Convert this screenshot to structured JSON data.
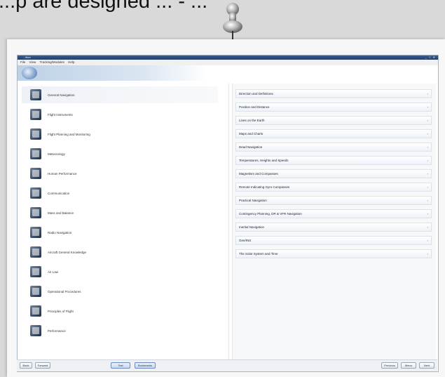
{
  "caption": "...p are designed ... - ...",
  "window": {
    "title": "...ition",
    "controls": "_ □ ✕"
  },
  "menu": [
    "File",
    "View",
    "Tracking/Modules",
    "Help"
  ],
  "left_items": [
    {
      "label": "General Navigation",
      "selected": true,
      "icon": "navigation-icon"
    },
    {
      "label": "Flight Instruments",
      "icon": "instruments-icon"
    },
    {
      "label": "Flight Planning and Monitoring",
      "icon": "planning-icon"
    },
    {
      "label": "Meteorology",
      "icon": "weather-icon"
    },
    {
      "label": "Human Performance",
      "icon": "human-icon"
    },
    {
      "label": "Communication",
      "icon": "radio-icon"
    },
    {
      "label": "Mass and Balance",
      "icon": "scale-icon"
    },
    {
      "label": "Radio Navigation",
      "icon": "radio-nav-icon"
    },
    {
      "label": "Aircraft General Knowledge",
      "icon": "aircraft-icon"
    },
    {
      "label": "Air Law",
      "icon": "law-icon"
    },
    {
      "label": "Operational Procedures",
      "icon": "procedures-icon"
    },
    {
      "label": "Principles of Flight",
      "icon": "flight-icon"
    },
    {
      "label": "Performance",
      "icon": "performance-icon"
    }
  ],
  "right_items": [
    {
      "label": "Direction and Definitions"
    },
    {
      "label": "Position and Distance"
    },
    {
      "label": "Lines on the Earth"
    },
    {
      "label": "Maps and Charts"
    },
    {
      "label": "Dead Navigation"
    },
    {
      "label": "Temperatures, Heights and Speeds"
    },
    {
      "label": "Magnetism and Compasses"
    },
    {
      "label": "Remote Indicating Gyro Compasses"
    },
    {
      "label": "Practical Navigation"
    },
    {
      "label": "Contingency Planning, DR & VFR Navigation"
    },
    {
      "label": "Inertial Navigation"
    },
    {
      "label": "Gee/INS"
    },
    {
      "label": "The Solar System and Time"
    }
  ],
  "arrow": "›",
  "bottom": {
    "back": "Back",
    "forward": "Forward",
    "test": "Test",
    "bookmarks": "Bookmarks",
    "previous": "Previous",
    "menu": "Menu",
    "next": "Next"
  }
}
